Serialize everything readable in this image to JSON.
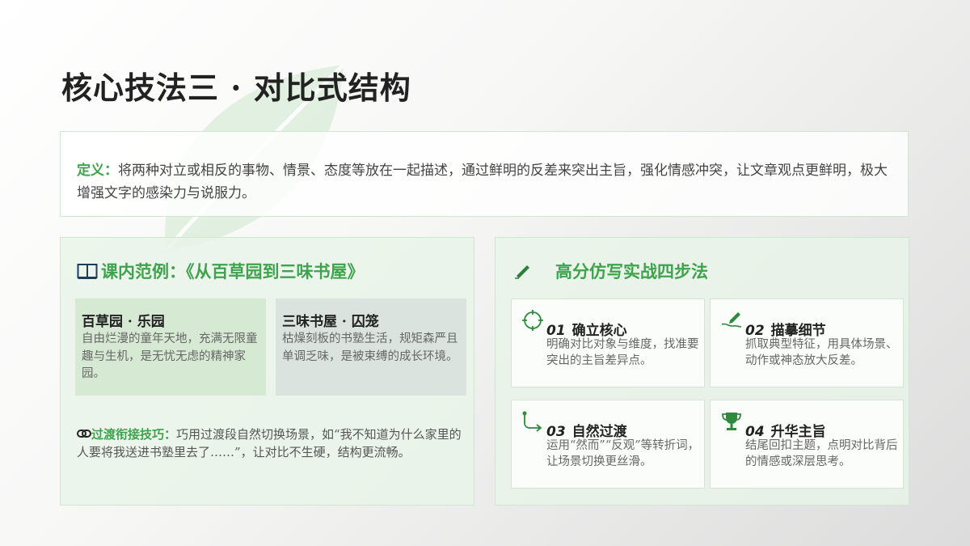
{
  "title": "核心技法三 · 对比式结构",
  "definition": {
    "label": "定义：",
    "text": "将两种对立或相反的事物、情景、态度等放在一起描述，通过鲜明的反差来突出主旨，强化情感冲突，让文章观点更鲜明，极大增强文字的感染力与说服力。"
  },
  "example": {
    "heading": "课内范例：《从百草园到三味书屋》",
    "cards": [
      {
        "title": "百草园 · 乐园",
        "desc": "自由烂漫的童年天地，充满无限童趣与生机，是无忧无虑的精神家园。"
      },
      {
        "title": "三味书屋 · 囚笼",
        "desc": "枯燥刻板的书塾生活，规矩森严且单调乏味，是被束缚的成长环境。"
      }
    ],
    "tip": {
      "label": "过渡衔接技巧：",
      "text": "巧用过渡段自然切换场景，如“我不知道为什么家里的人要将我送进书塾里去了……”，让对比不生硬，结构更流畅。"
    }
  },
  "method": {
    "heading": "高分仿写实战四步法",
    "steps": [
      {
        "num": "01",
        "title": "确立核心",
        "desc": "明确对比对象与维度，找准要突出的主旨差异点。",
        "icon": "target-icon"
      },
      {
        "num": "02",
        "title": "描摹细节",
        "desc": "抓取典型特征，用具体场景、动作或神态放大反差。",
        "icon": "pen-icon"
      },
      {
        "num": "03",
        "title": "自然过渡",
        "desc": "运用“然而”“反观”等转折词，让场景切换更丝滑。",
        "icon": "route-icon"
      },
      {
        "num": "04",
        "title": "升华主旨",
        "desc": "结尾回扣主题，点明对比背后的情感或深层思考。",
        "icon": "trophy-icon"
      }
    ]
  },
  "colors": {
    "accent": "#3fa34d",
    "panel": "#e8f4e8",
    "card_green": "#d6ead3",
    "card_gray": "#dbe3df"
  }
}
